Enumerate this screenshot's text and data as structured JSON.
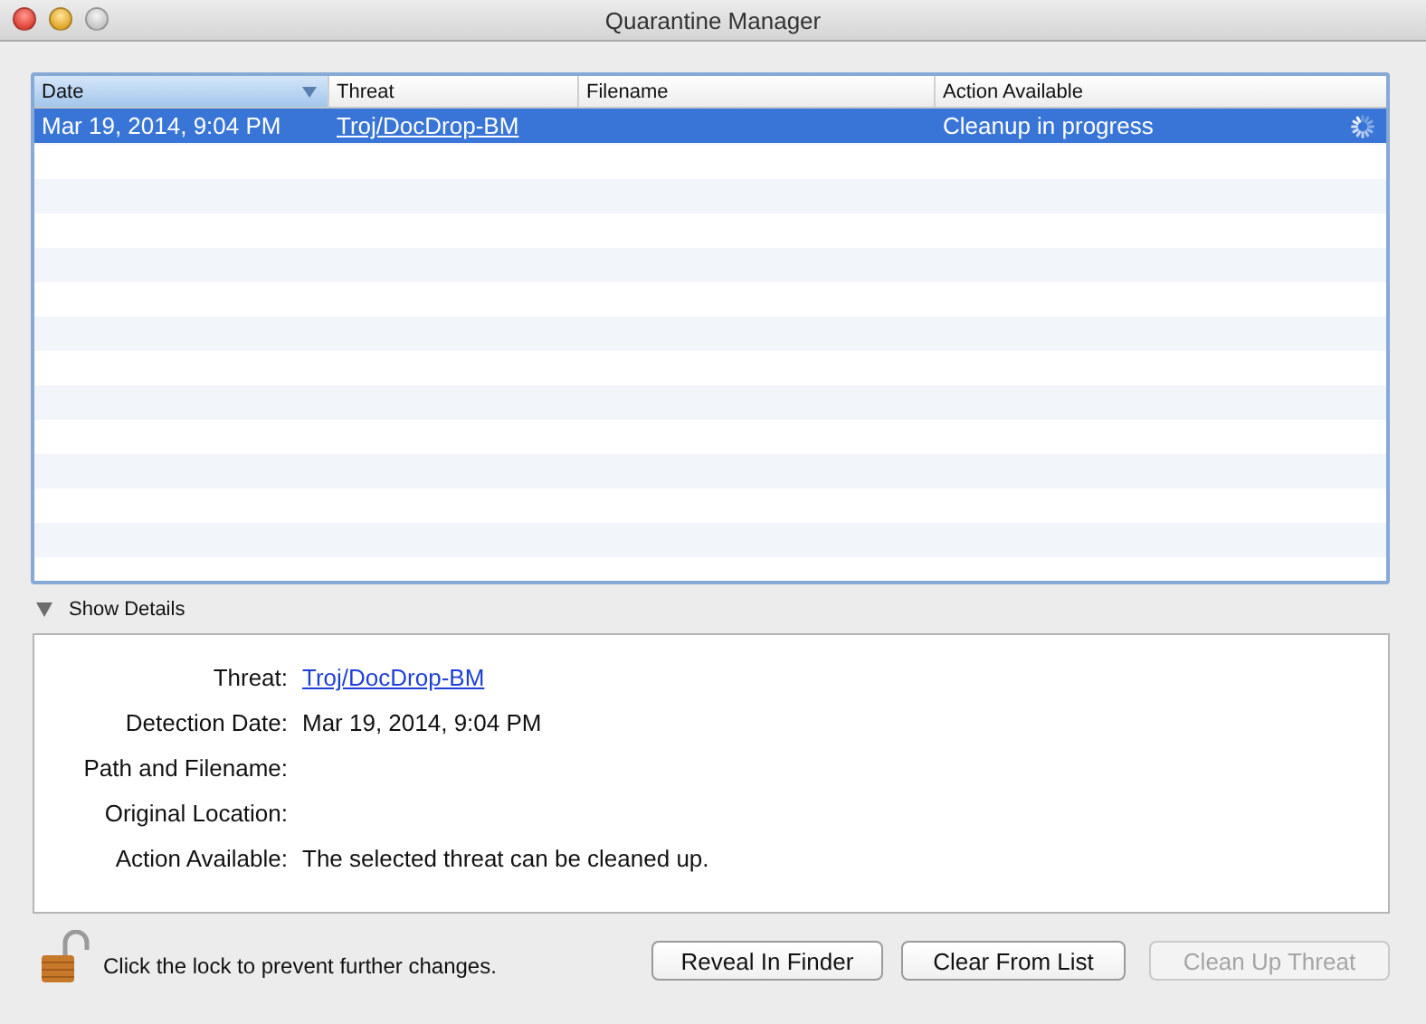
{
  "window": {
    "title": "Quarantine Manager"
  },
  "table": {
    "columns": [
      {
        "label": "Date",
        "sorted": true
      },
      {
        "label": "Threat",
        "sorted": false
      },
      {
        "label": "Filename",
        "sorted": false
      },
      {
        "label": "Action Available",
        "sorted": false
      }
    ],
    "rows": [
      {
        "date": "Mar 19, 2014, 9:04 PM",
        "threat": "Troj/DocDrop-BM",
        "action": "Cleanup in progress",
        "busy": true,
        "selected": true
      }
    ]
  },
  "details": {
    "toggle": "Show Details",
    "expanded": true,
    "fields": [
      {
        "label": "Threat:",
        "value": "Troj/DocDrop-BM",
        "kind": "link"
      },
      {
        "label": "Detection Date:",
        "value": "Mar 19, 2014, 9:04 PM",
        "kind": "text"
      },
      {
        "label": "Path and Filename:"
      },
      {
        "label": "Original Location:"
      },
      {
        "label": "Action Available:",
        "value": "The selected threat can be cleaned up.",
        "kind": "text"
      }
    ]
  },
  "lock": {
    "locked": false,
    "text": "Click the lock to prevent further changes."
  },
  "buttons": [
    {
      "label": "Reveal In Finder",
      "disabled": false
    },
    {
      "label": "Clear From List",
      "disabled": false
    },
    {
      "label": "Clean Up Threat",
      "disabled": true
    }
  ]
}
